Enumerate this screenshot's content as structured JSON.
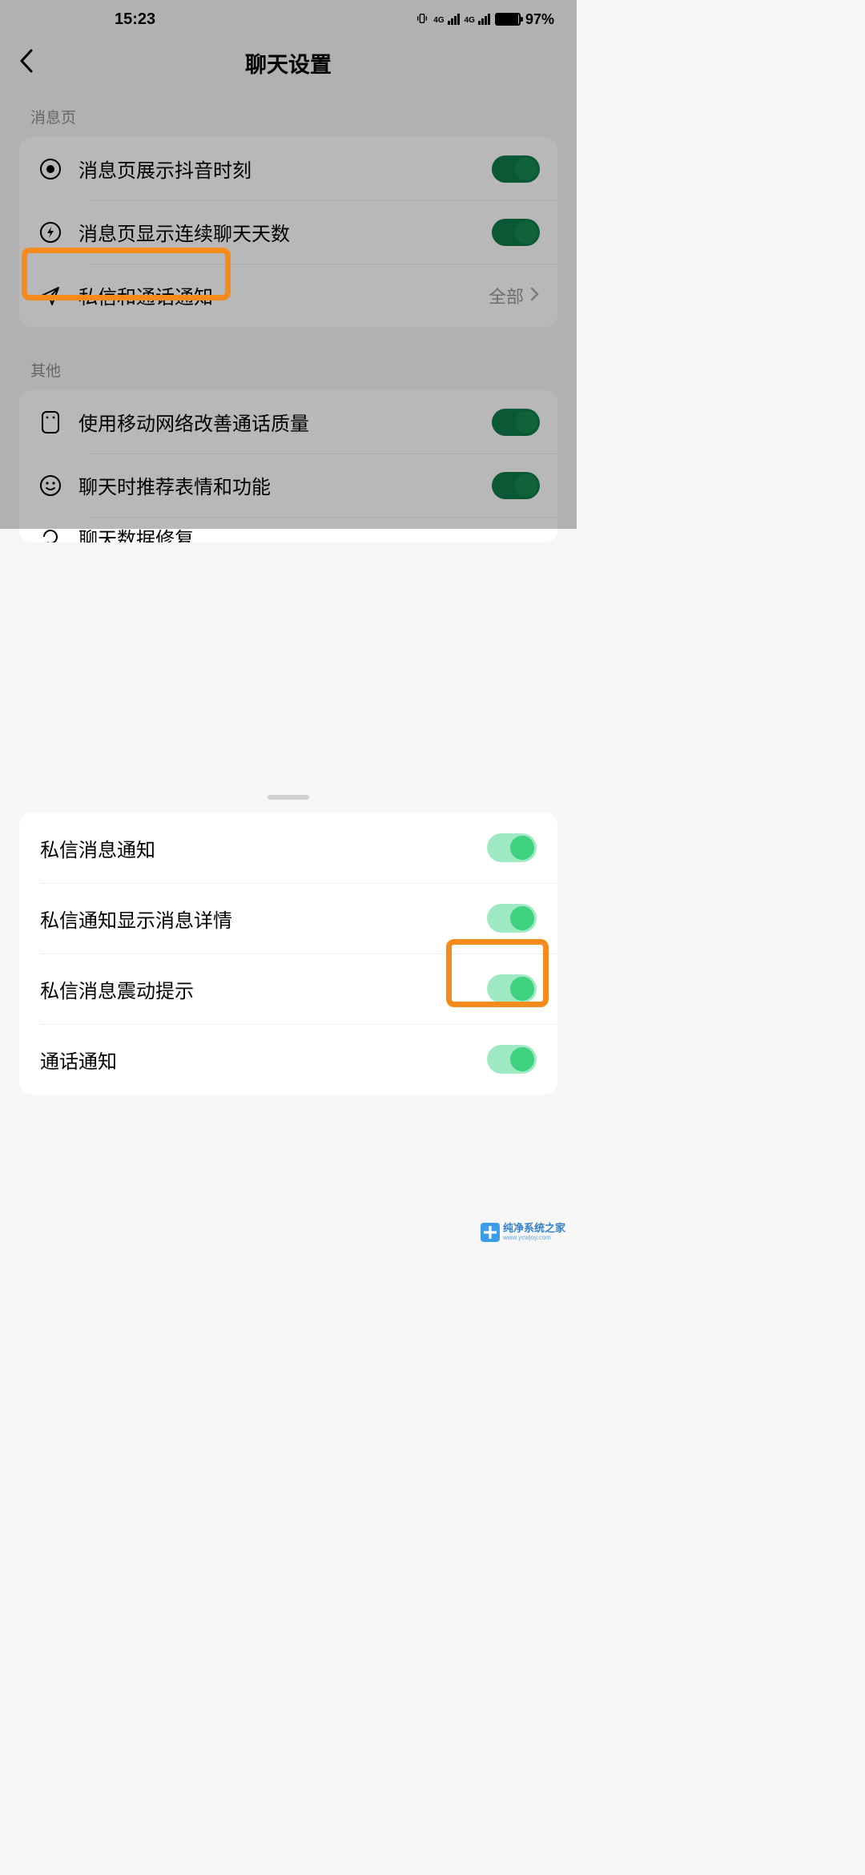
{
  "status": {
    "time": "15:23",
    "signal1_label": "4G",
    "signal2_label": "4G",
    "battery_pct": "97%"
  },
  "nav": {
    "title": "聊天设置"
  },
  "sections": {
    "messages": {
      "label": "消息页",
      "row1": {
        "label": "消息页展示抖音时刻"
      },
      "row2": {
        "label": "消息页显示连续聊天天数"
      },
      "row3": {
        "label": "私信和通话通知",
        "value": "全部"
      }
    },
    "other": {
      "label": "其他",
      "row1": {
        "label": "使用移动网络改善通话质量"
      },
      "row2": {
        "label": "聊天时推荐表情和功能"
      },
      "row3_partial": {
        "label": "聊天数据修复"
      }
    }
  },
  "sheet": {
    "row1": "私信消息通知",
    "row2": "私信通知显示消息详情",
    "row3": "私信消息震动提示",
    "row4": "通话通知"
  },
  "watermark": {
    "main": "纯净系统之家",
    "sub": "www.ycwjoy.com"
  }
}
